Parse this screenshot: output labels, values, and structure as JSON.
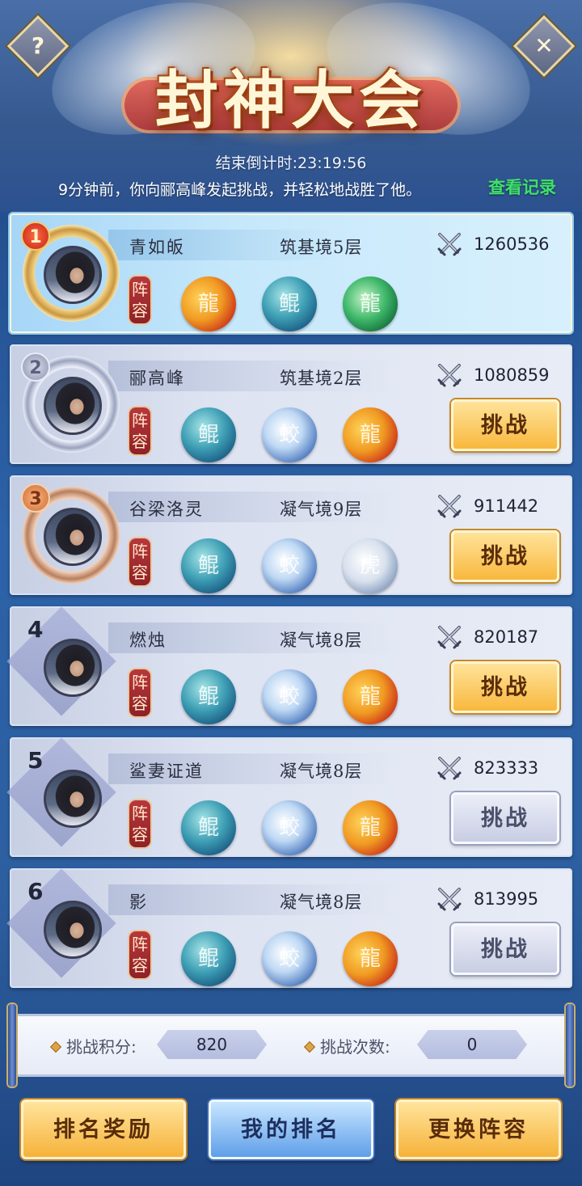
{
  "header": {
    "title": "封神大会",
    "countdown_label": "结束倒计时:",
    "countdown_value": "23:19:56",
    "last_battle_log": "9分钟前，你向郦高峰发起挑战，并轻松地战胜了他。",
    "view_records": "查看记录",
    "help_icon_glyph": "?",
    "close_icon_glyph": "✕"
  },
  "lineup_tag": "阵容",
  "players": [
    {
      "rank": "1",
      "name": "青如皈",
      "realm": "筑基境5层",
      "power": "1260536",
      "frame": "gold",
      "pets": [
        "fire-dragon",
        "whale",
        "jade-dragon"
      ],
      "challenge": null
    },
    {
      "rank": "2",
      "name": "郦高峰",
      "realm": "筑基境2层",
      "power": "1080859",
      "frame": "silver",
      "pets": [
        "whale",
        "ice-dragon",
        "fire-dragon"
      ],
      "challenge": "挑战",
      "challenge_state": "active"
    },
    {
      "rank": "3",
      "name": "谷梁洛灵",
      "realm": "凝气境9层",
      "power": "911442",
      "frame": "bronze",
      "pets": [
        "whale",
        "ice-dragon",
        "white-tiger"
      ],
      "challenge": "挑战",
      "challenge_state": "active"
    },
    {
      "rank": "4",
      "name": "燃烛",
      "realm": "凝气境8层",
      "power": "820187",
      "frame": "plain",
      "pets": [
        "whale",
        "ice-dragon",
        "fire-dragon"
      ],
      "challenge": "挑战",
      "challenge_state": "active"
    },
    {
      "rank": "5",
      "name": "鲨妻证道",
      "realm": "凝气境8层",
      "power": "823333",
      "frame": "plain",
      "pets": [
        "whale",
        "ice-dragon",
        "fire-dragon"
      ],
      "challenge": "挑战",
      "challenge_state": "disabled"
    },
    {
      "rank": "6",
      "name": "影",
      "realm": "凝气境8层",
      "power": "813995",
      "frame": "plain",
      "pets": [
        "whale",
        "ice-dragon",
        "fire-dragon"
      ],
      "challenge": "挑战",
      "challenge_state": "disabled"
    }
  ],
  "stats": {
    "points_label": "挑战积分:",
    "points_value": "820",
    "attempts_label": "挑战次数:",
    "attempts_value": "0"
  },
  "bottom_buttons": {
    "rank_rewards": "排名奖励",
    "my_rank": "我的排名",
    "change_lineup": "更换阵容"
  },
  "colors": {
    "accent_gold": "#f8b83d",
    "first_row_blue": "#c6e8fb",
    "view_records_green": "#3ee06a",
    "lineup_red": "#b8383c"
  }
}
